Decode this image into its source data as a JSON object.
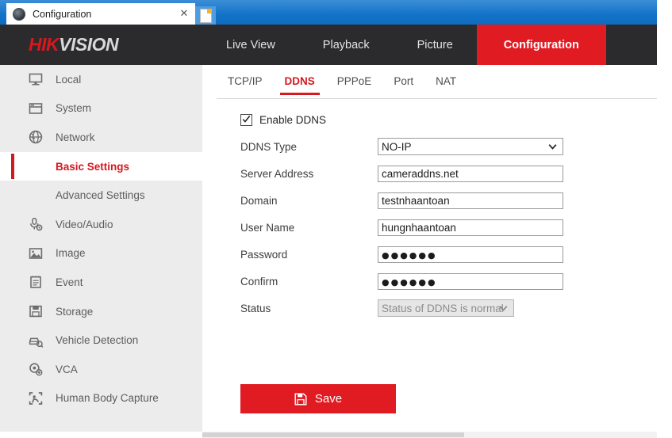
{
  "browser": {
    "tab_title": "Configuration",
    "favicon": "camera-icon",
    "close_label": "✕",
    "new_tab_label": "new-tab-icon"
  },
  "header": {
    "brand_first": "HIK",
    "brand_second": "VISION",
    "nav": [
      {
        "label": "Live View",
        "active": false
      },
      {
        "label": "Playback",
        "active": false
      },
      {
        "label": "Picture",
        "active": false
      },
      {
        "label": "Configuration",
        "active": true
      }
    ]
  },
  "sidebar": {
    "items": [
      {
        "label": "Local",
        "icon": "monitor-icon"
      },
      {
        "label": "System",
        "icon": "window-icon"
      },
      {
        "label": "Network",
        "icon": "globe-icon"
      },
      {
        "label": "Basic Settings",
        "icon": "",
        "sub": true,
        "active": true
      },
      {
        "label": "Advanced Settings",
        "icon": "",
        "sub": true,
        "active": false
      },
      {
        "label": "Video/Audio",
        "icon": "mic-icon"
      },
      {
        "label": "Image",
        "icon": "picture-icon"
      },
      {
        "label": "Event",
        "icon": "clipboard-icon"
      },
      {
        "label": "Storage",
        "icon": "floppy-icon"
      },
      {
        "label": "Vehicle Detection",
        "icon": "car-search-icon"
      },
      {
        "label": "VCA",
        "icon": "vca-icon"
      },
      {
        "label": "Human Body Capture",
        "icon": "person-capture-icon"
      }
    ]
  },
  "content": {
    "tabs": [
      {
        "label": "TCP/IP",
        "active": false
      },
      {
        "label": "DDNS",
        "active": true
      },
      {
        "label": "PPPoE",
        "active": false
      },
      {
        "label": "Port",
        "active": false
      },
      {
        "label": "NAT",
        "active": false
      }
    ],
    "enable_ddns": {
      "label": "Enable DDNS",
      "checked": true
    },
    "fields": [
      {
        "label": "DDNS Type",
        "type": "select",
        "value": "NO-IP",
        "disabled": false
      },
      {
        "label": "Server Address",
        "type": "text",
        "value": "cameraddns.net"
      },
      {
        "label": "Domain",
        "type": "text",
        "value": "testnhaantoan"
      },
      {
        "label": "User Name",
        "type": "text",
        "value": "hungnhaantoan"
      },
      {
        "label": "Password",
        "type": "password",
        "value": "●●●●●●"
      },
      {
        "label": "Confirm",
        "type": "password",
        "value": "●●●●●●"
      },
      {
        "label": "Status",
        "type": "select",
        "value": "Status of DDNS is normal",
        "disabled": true
      }
    ],
    "save_button": {
      "label": "Save",
      "icon": "floppy-save-icon"
    }
  },
  "colors": {
    "brand_red": "#d6181f",
    "nav_active_red": "#e01b22",
    "header_dark": "#2b2b2d",
    "sidebar_gray": "#ececec",
    "title_blue": "#1273c8"
  }
}
